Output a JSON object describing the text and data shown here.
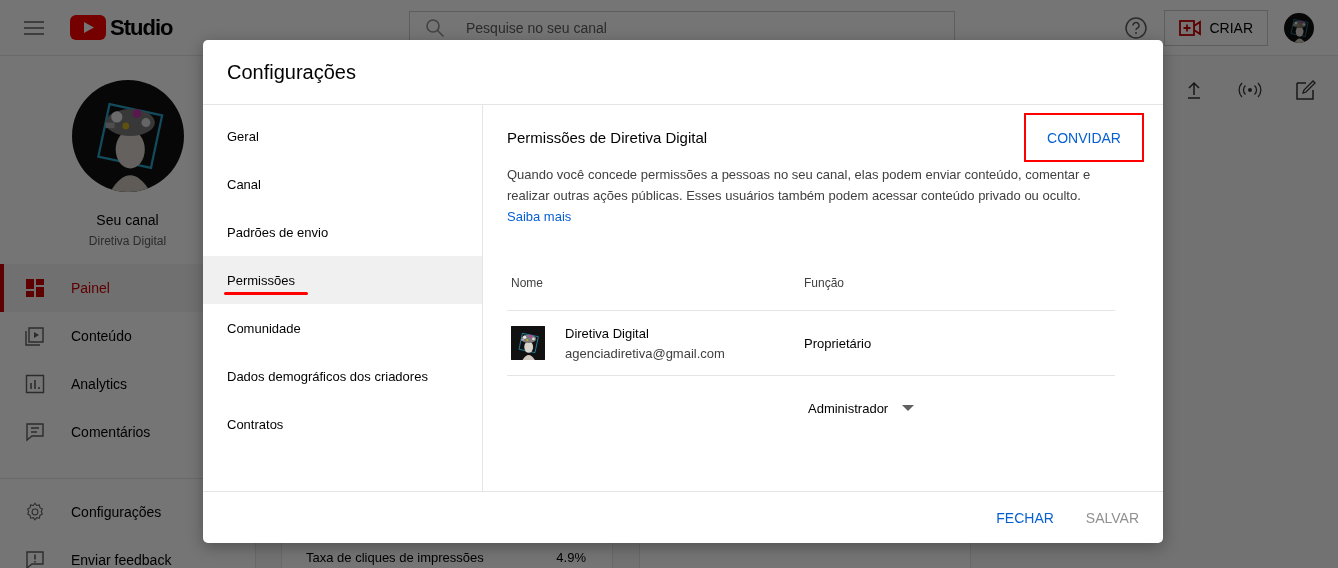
{
  "topbar": {
    "logo_text": "Studio",
    "search": {
      "placeholder": "Pesquise no seu canal"
    },
    "create_label": "CRIAR"
  },
  "channel": {
    "title": "Seu canal",
    "name": "Diretiva Digital"
  },
  "sidebar": {
    "items": [
      {
        "label": "Painel",
        "kind": "dashboard",
        "selected": true
      },
      {
        "label": "Conteúdo",
        "kind": "content",
        "selected": false
      },
      {
        "label": "Analytics",
        "kind": "analytics",
        "selected": false
      },
      {
        "label": "Comentários",
        "kind": "comments",
        "selected": false
      }
    ],
    "footer_items": [
      {
        "label": "Configurações",
        "kind": "settings"
      },
      {
        "label": "Enviar feedback",
        "kind": "feedback"
      }
    ]
  },
  "background_card": {
    "metric_label": "Taxa de cliques de impressões",
    "metric_value": "4.9%"
  },
  "dialog": {
    "title": "Configurações",
    "nav": [
      {
        "label": "Geral",
        "selected": false,
        "underlined": false
      },
      {
        "label": "Canal",
        "selected": false,
        "underlined": false
      },
      {
        "label": "Padrões de envio",
        "selected": false,
        "underlined": false
      },
      {
        "label": "Permissões",
        "selected": true,
        "underlined": true
      },
      {
        "label": "Comunidade",
        "selected": false,
        "underlined": false
      },
      {
        "label": "Dados demográficos dos criadores",
        "selected": false,
        "underlined": false
      },
      {
        "label": "Contratos",
        "selected": false,
        "underlined": false
      }
    ],
    "section_title": "Permissões de Diretiva Digital",
    "invite": {
      "label": "CONVIDAR",
      "highlighted": true
    },
    "description": "Quando você concede permissões a pessoas no seu canal, elas podem enviar conteúdo, comentar e realizar outras ações públicas. Esses usuários também podem acessar conteúdo privado ou oculto.",
    "learn_more": "Saiba mais",
    "columns": [
      "Nome",
      "Função"
    ],
    "members": [
      {
        "name": "Diretiva Digital",
        "email": "agenciadiretiva@gmail.com",
        "role": "Proprietário"
      }
    ],
    "new_role": "Administrador",
    "buttons": [
      {
        "label": "FECHAR",
        "disabled": false
      },
      {
        "label": "SALVAR",
        "disabled": true
      }
    ]
  }
}
